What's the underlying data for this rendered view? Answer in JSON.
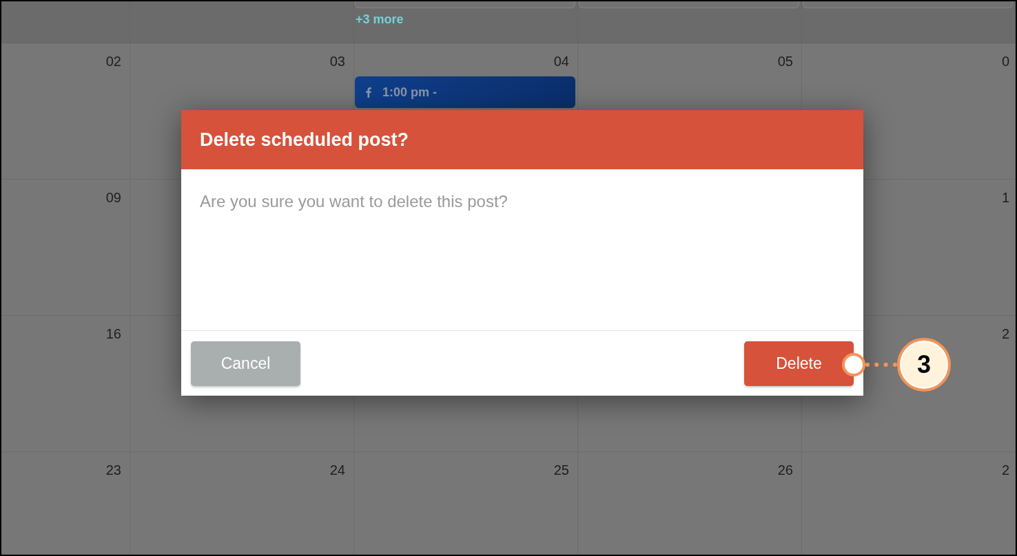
{
  "calendar": {
    "overflow_row": [
      {
        "event_edge": false
      },
      {
        "event_edge": false
      },
      {
        "event_edge": true,
        "more_link": "+3 more"
      },
      {
        "event_edge": true
      },
      {
        "event_edge": true
      }
    ],
    "weeks": [
      {
        "days": [
          {
            "date": "02"
          },
          {
            "date": "03"
          },
          {
            "date": "04",
            "events": [
              {
                "time": "1:00 pm -"
              }
            ]
          },
          {
            "date": "05"
          },
          {
            "date": "0"
          }
        ]
      },
      {
        "days": [
          {
            "date": "09"
          },
          {
            "date": "1"
          }
        ]
      },
      {
        "days": [
          {
            "date": "16"
          },
          {
            "date": "2"
          }
        ]
      },
      {
        "days": [
          {
            "date": "23"
          },
          {
            "date": "24"
          },
          {
            "date": "25"
          },
          {
            "date": "26"
          },
          {
            "date": "2"
          }
        ]
      }
    ]
  },
  "dialog": {
    "title": "Delete scheduled post?",
    "message": "Are you sure you want to delete this post?",
    "buttons": [
      {
        "label": "Cancel",
        "kind": "secondary"
      },
      {
        "label": "Delete",
        "kind": "danger"
      }
    ]
  },
  "callout": {
    "number": "3"
  }
}
